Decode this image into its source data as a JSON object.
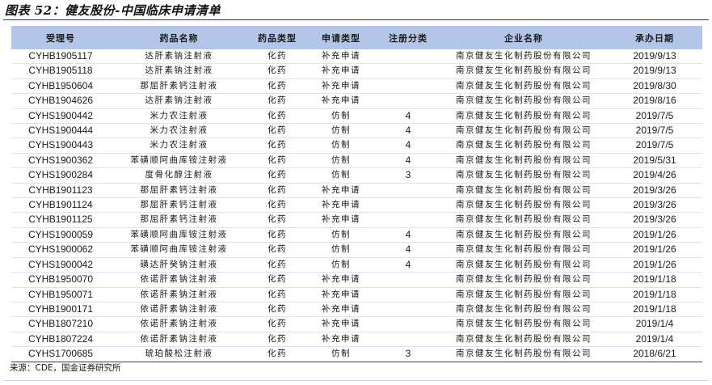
{
  "title": "图表 52：健友股份-中国临床申请清单",
  "source": "来源：CDE，国金证券研究所",
  "colors": {
    "header_background": "#b4c6e7",
    "rule": "#1f3f80"
  },
  "table": {
    "columns": [
      "受理号",
      "药品名称",
      "药品类型",
      "申请类型",
      "注册分类",
      "企业名称",
      "承办日期"
    ],
    "rows": [
      [
        "CYHB1905117",
        "达肝素钠注射液",
        "化药",
        "补充申请",
        "",
        "南京健友生化制药股份有限公司",
        "2019/9/13"
      ],
      [
        "CYHB1905118",
        "达肝素钠注射液",
        "化药",
        "补充申请",
        "",
        "南京健友生化制药股份有限公司",
        "2019/9/13"
      ],
      [
        "CYHB1950604",
        "那屈肝素钙注射液",
        "化药",
        "补充申请",
        "",
        "南京健友生化制药股份有限公司",
        "2019/8/30"
      ],
      [
        "CYHB1904626",
        "达肝素钠注射液",
        "化药",
        "补充申请",
        "",
        "南京健友生化制药股份有限公司",
        "2019/8/16"
      ],
      [
        "CYHS1900442",
        "米力农注射液",
        "化药",
        "仿制",
        "4",
        "南京健友生化制药股份有限公司",
        "2019/7/5"
      ],
      [
        "CYHS1900444",
        "米力农注射液",
        "化药",
        "仿制",
        "4",
        "南京健友生化制药股份有限公司",
        "2019/7/5"
      ],
      [
        "CYHS1900443",
        "米力农注射液",
        "化药",
        "仿制",
        "4",
        "南京健友生化制药股份有限公司",
        "2019/7/5"
      ],
      [
        "CYHS1900362",
        "苯磺顺阿曲库铵注射液",
        "化药",
        "仿制",
        "4",
        "南京健友生化制药股份有限公司",
        "2019/5/31"
      ],
      [
        "CYHS1900284",
        "度骨化醇注射液",
        "化药",
        "仿制",
        "3",
        "南京健友生化制药股份有限公司",
        "2019/4/26"
      ],
      [
        "CYHB1901123",
        "那屈肝素钙注射液",
        "化药",
        "补充申请",
        "",
        "南京健友生化制药股份有限公司",
        "2019/3/26"
      ],
      [
        "CYHB1901124",
        "那屈肝素钙注射液",
        "化药",
        "补充申请",
        "",
        "南京健友生化制药股份有限公司",
        "2019/3/26"
      ],
      [
        "CYHB1901125",
        "那屈肝素钙注射液",
        "化药",
        "补充申请",
        "",
        "南京健友生化制药股份有限公司",
        "2019/3/26"
      ],
      [
        "CYHS1900059",
        "苯磺顺阿曲库铵注射液",
        "化药",
        "仿制",
        "4",
        "南京健友生化制药股份有限公司",
        "2019/1/26"
      ],
      [
        "CYHS1900062",
        "苯磺顺阿曲库铵注射液",
        "化药",
        "仿制",
        "4",
        "南京健友生化制药股份有限公司",
        "2019/1/26"
      ],
      [
        "CYHS1900042",
        "磺达肝癸钠注射液",
        "化药",
        "仿制",
        "4",
        "南京健友生化制药股份有限公司",
        "2019/1/26"
      ],
      [
        "CYHB1950070",
        "依诺肝素钠注射液",
        "化药",
        "补充申请",
        "",
        "南京健友生化制药股份有限公司",
        "2019/1/18"
      ],
      [
        "CYHB1950071",
        "依诺肝素钠注射液",
        "化药",
        "补充申请",
        "",
        "南京健友生化制药股份有限公司",
        "2019/1/18"
      ],
      [
        "CYHB1900171",
        "依诺肝素钠注射液",
        "化药",
        "补充申请",
        "",
        "南京健友生化制药股份有限公司",
        "2019/1/18"
      ],
      [
        "CYHB1807210",
        "依诺肝素钠注射液",
        "化药",
        "补充申请",
        "",
        "南京健友生化制药股份有限公司",
        "2019/1/4"
      ],
      [
        "CYHB1807224",
        "依诺肝素钠注射液",
        "化药",
        "补充申请",
        "",
        "南京健友生化制药股份有限公司",
        "2019/1/4"
      ],
      [
        "CYHS1700685",
        "琥珀酸松注射液",
        "化药",
        "仿制",
        "3",
        "南京健友生化制药股份有限公司",
        "2018/6/21"
      ]
    ]
  }
}
